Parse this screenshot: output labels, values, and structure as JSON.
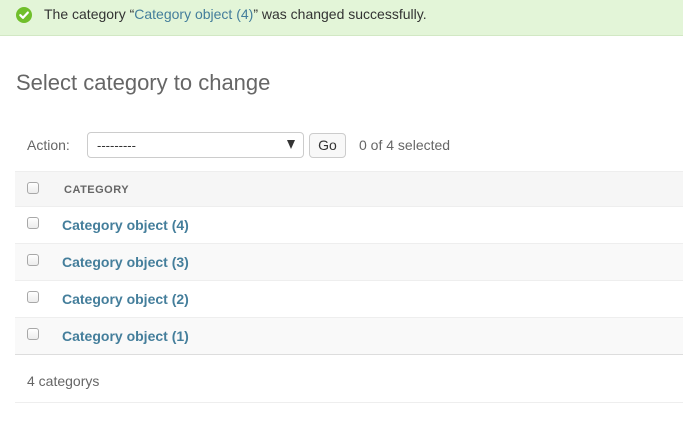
{
  "message": {
    "prefix": "The category “",
    "link_text": "Category object (4)",
    "suffix": "” was changed successfully.",
    "status_color": "#70bf2b",
    "icon": "check-circle-icon"
  },
  "page": {
    "title": "Select category to change"
  },
  "actions": {
    "label": "Action:",
    "select_value": "---------",
    "go_label": "Go",
    "selection_count": "0 of 4 selected"
  },
  "table": {
    "column_header": "Category",
    "rows": [
      {
        "label": "Category object (4)"
      },
      {
        "label": "Category object (3)"
      },
      {
        "label": "Category object (2)"
      },
      {
        "label": "Category object (1)"
      }
    ]
  },
  "paginator": {
    "text": "4 categorys"
  },
  "colors": {
    "link": "#447e9b",
    "success_bg": "#e3f5d8"
  }
}
